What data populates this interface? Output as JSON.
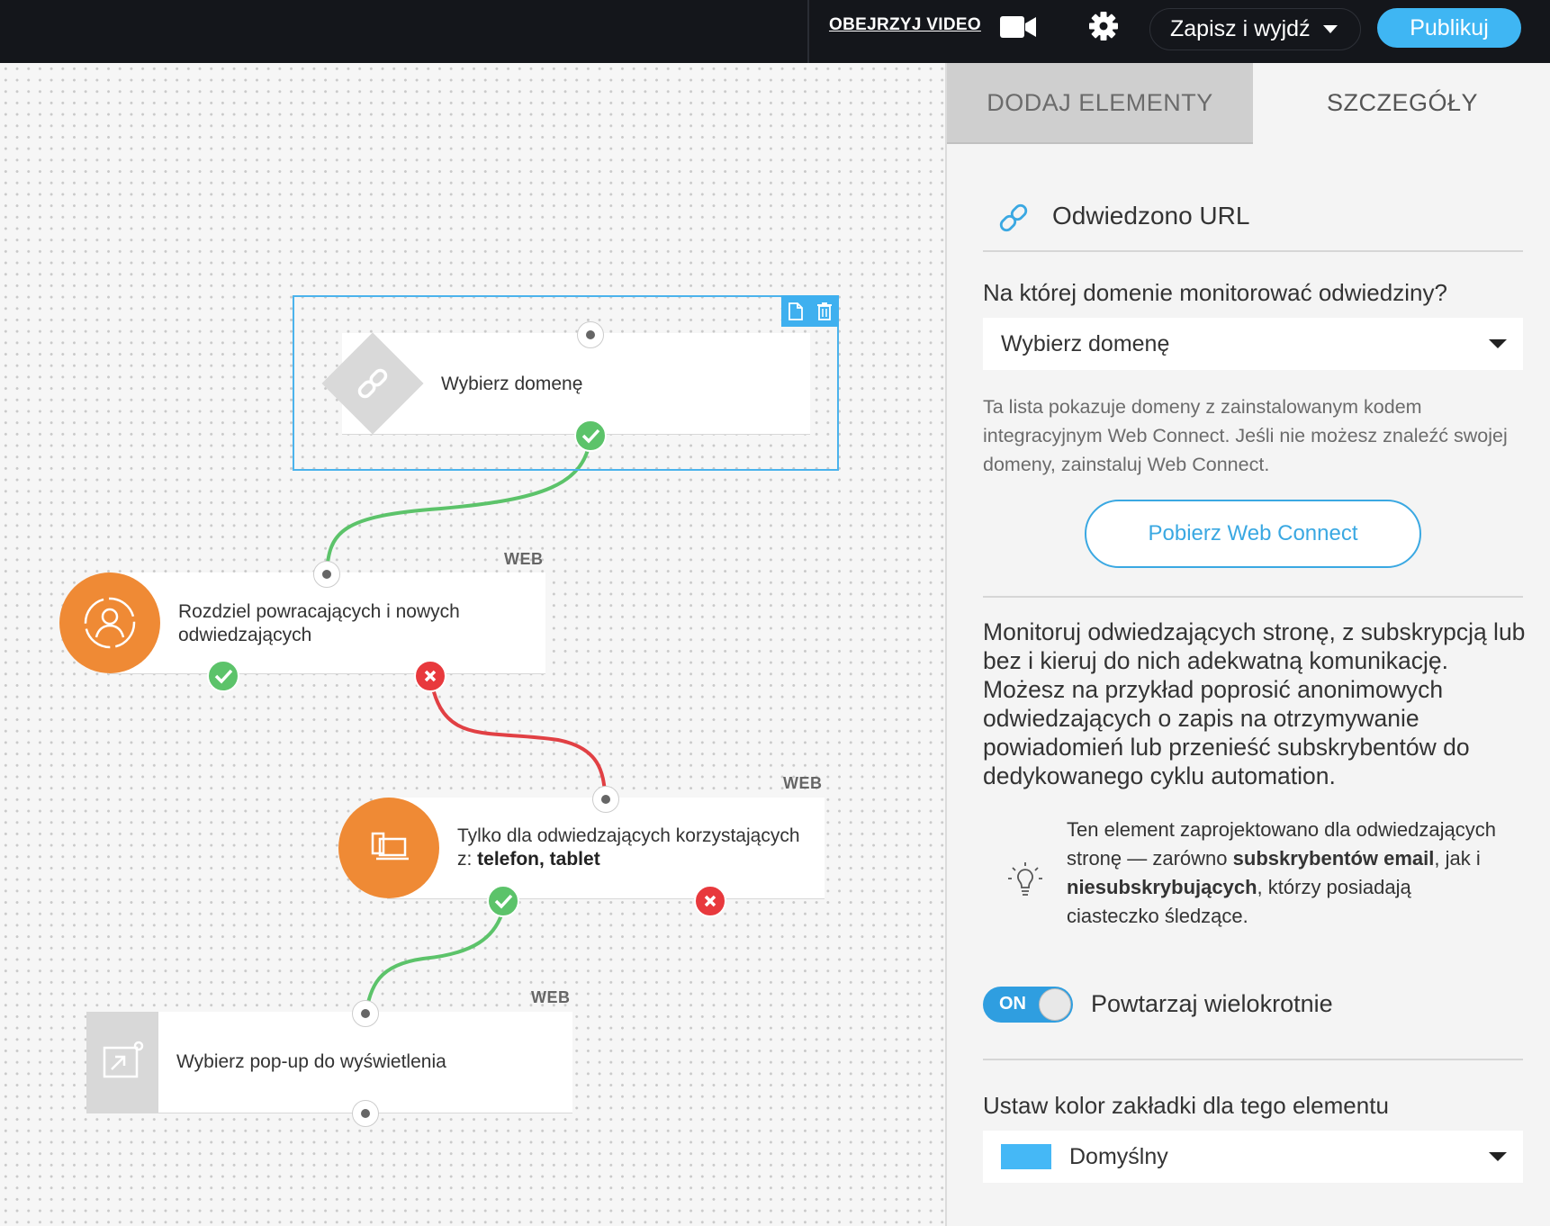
{
  "topbar": {
    "video_link": "OBEJRZYJ VIDEO",
    "save_exit": "Zapisz i wyjdź",
    "publish": "Publikuj"
  },
  "canvas": {
    "nodes": [
      {
        "label": "Wybierz domenę"
      },
      {
        "label": "Rozdziel powracających i nowych odwiedzających",
        "tag": "WEB"
      },
      {
        "label_prefix": "Tylko dla odwiedzających korzystających z: ",
        "label_bold": "telefon, tablet",
        "tag": "WEB"
      },
      {
        "label": "Wybierz pop-up do wyświetlenia",
        "tag": "WEB"
      }
    ]
  },
  "panel": {
    "tabs": [
      {
        "label": "DODAJ ELEMENTY",
        "active": true
      },
      {
        "label": "SZCZEGÓŁY",
        "active": false
      }
    ],
    "title": "Odwiedzono URL",
    "domain_question": "Na której domenie monitorować odwiedziny?",
    "domain_select": "Wybierz domenę",
    "domain_hint": "Ta lista pokazuje domeny z zainstalowanym kodem integracyjnym Web Connect. Jeśli nie możesz znaleźć swojej domeny, zainstaluj Web Connect.",
    "webconnect_button": "Pobierz Web Connect",
    "description": "Monitoruj odwiedzających stronę, z subskrypcją lub bez i kieruj do nich adekwatną komunikację. Możesz na przykład poprosić anonimowych odwiedzających o zapis na otrzymywanie powiadomień lub przenieść subskrybentów do dedykowanego cyklu automation.",
    "tip": {
      "part1": "Ten element zaprojektowano dla odwiedzających stronę — zarówno ",
      "bold1": "subskrybentów email",
      "part2": ", jak i ",
      "bold2": "niesubskrybujących",
      "part3": ", którzy posiadają ciasteczko śledzące."
    },
    "toggle_state": "ON",
    "repeat_label": "Powtarzaj wielokrotnie",
    "color_question": "Ustaw kolor zakładki dla tego elementu",
    "color_select": "Domyślny",
    "color_swatch": "#45b8f6"
  }
}
